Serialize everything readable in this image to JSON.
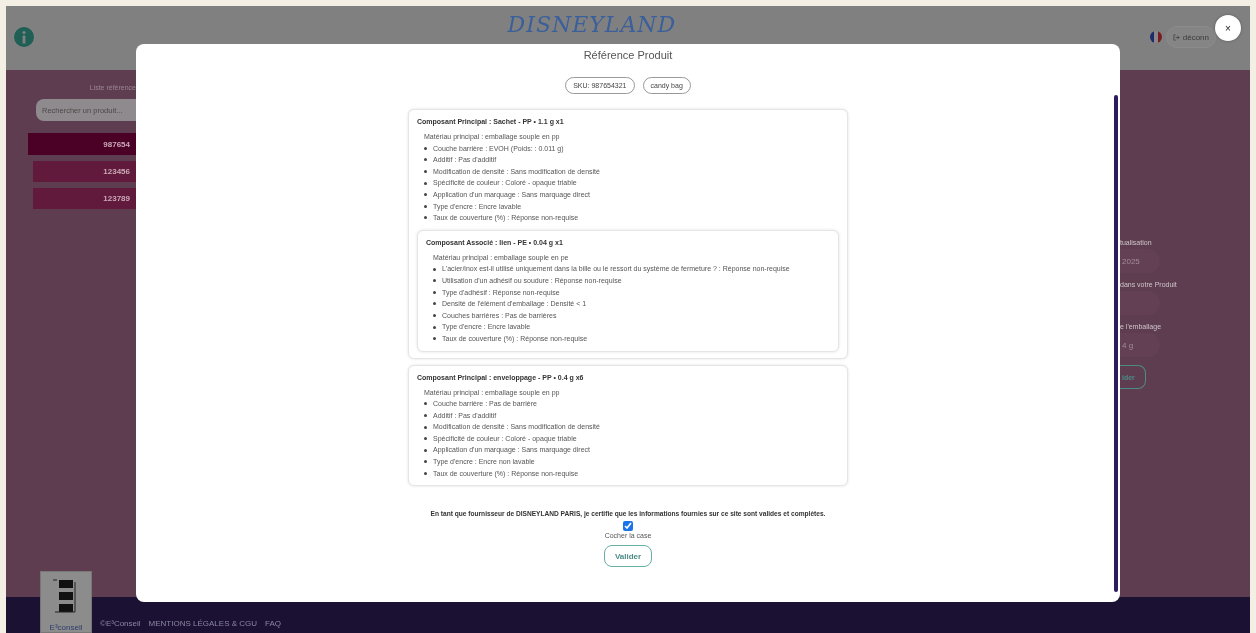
{
  "header": {
    "logo_text": "DISNEYLAND",
    "logout_label": "déconn"
  },
  "sidebar": {
    "title": "Liste référence",
    "search": {
      "placeholder": "Rechercher un produit..."
    },
    "items": [
      {
        "label": "987654",
        "selected": true
      },
      {
        "label": "123456",
        "selected": false
      },
      {
        "label": "123789",
        "selected": false
      }
    ]
  },
  "right_panel": {
    "fields": [
      {
        "label": "tualisation",
        "value": "2025"
      },
      {
        "label": "dans votre Produit"
      },
      {
        "label": "e l'emballage",
        "value": "4 g"
      }
    ],
    "button_label": "ider"
  },
  "footer": {
    "logo_text": "E³conseil",
    "copyright": "©E³Conseil",
    "links": [
      "MENTIONS LÉGALES & CGU",
      "FAQ"
    ]
  },
  "modal": {
    "title": "Référence Produit",
    "close_label": "×",
    "chips": [
      "SKU: 987654321",
      "candy bag"
    ],
    "components": [
      {
        "title": "Composant Principal : Sachet - PP • 1.1 g x1",
        "material": "Matériau principal : emballage souple en pp",
        "properties": [
          "Couche barrière : EVOH (Poids: : 0.011 g)",
          "Additif : Pas d'additif",
          "Modification de densité : Sans modification de densité",
          "Spécificité de couleur : Coloré - opaque triable",
          "Application d'un marquage : Sans marquage direct",
          "Type d'encre : Encre lavable",
          "Taux de couverture (%) : Réponse non-requise"
        ],
        "children": [
          {
            "title": "Composant Associé : lien - PE • 0.04 g x1",
            "material": "Matériau principal : emballage souple en pe",
            "properties": [
              "L'acier/inox est-il utilisé uniquement dans la bille ou le ressort du système de fermeture ? : Réponse non-requise",
              "Utilisation d'un adhésif ou soudure : Réponse non-requise",
              "Type d'adhésif : Réponse non-requise",
              "Densité de l'élément d'emballage : Densité < 1",
              "Couches barrières : Pas de barrières",
              "Type d'encre : Encre lavable",
              "Taux de couverture (%) : Réponse non-requise"
            ]
          }
        ]
      },
      {
        "title": "Composant Principal : enveloppage - PP • 0.4 g x6",
        "material": "Matériau principal : emballage souple en pp",
        "properties": [
          "Couche barrière : Pas de barrière",
          "Additif : Pas d'additif",
          "Modification de densité : Sans modification de densité",
          "Spécificité de couleur : Coloré - opaque triable",
          "Application d'un marquage : Sans marquage direct",
          "Type d'encre : Encre non lavable",
          "Taux de couverture (%) : Réponse non-requise"
        ]
      }
    ],
    "certification": {
      "text": "En tant que fournisseur de DISNEYLAND PARIS, je certifie que les informations fournies sur ce site sont valides et complètes.",
      "checked": true,
      "checkbox_label": "Cocher la case"
    },
    "submit_label": "Valider"
  }
}
